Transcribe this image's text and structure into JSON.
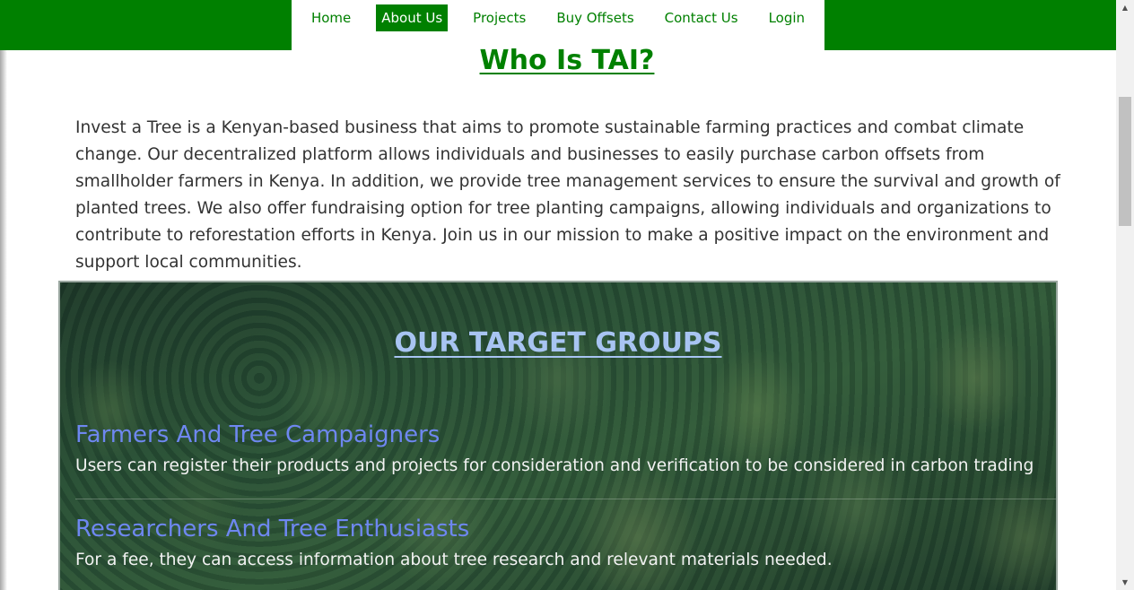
{
  "nav": {
    "items": [
      {
        "label": "Home"
      },
      {
        "label": "About Us"
      },
      {
        "label": "Projects"
      },
      {
        "label": "Buy Offsets"
      },
      {
        "label": "Contact Us"
      },
      {
        "label": "Login"
      }
    ],
    "active": "About Us"
  },
  "about": {
    "title": "Who Is TAI?",
    "body": "Invest a Tree is a Kenyan-based business that aims to promote sustainable farming practices and combat climate change. Our decentralized platform allows individuals and businesses to easily purchase carbon offsets from smallholder farmers in Kenya. In addition, we provide tree management services to ensure the survival and growth of planted trees. We also offer fundraising option for tree planting campaigns, allowing individuals and organizations to contribute to reforestation efforts in Kenya. Join us in our mission to make a positive impact on the environment and support local communities."
  },
  "target_groups": {
    "title": "OUR TARGET GROUPS",
    "groups": [
      {
        "heading": "Farmers And Tree Campaigners",
        "text": "Users can register their products and projects for consideration and verification to be considered in carbon trading"
      },
      {
        "heading": "Researchers And Tree Enthusiasts",
        "text": "For a fee, they can access information about tree research and relevant materials needed."
      }
    ]
  },
  "colors": {
    "brand_green": "#008000",
    "group_heading": "#6e87f0",
    "section_title": "#a8c4f2"
  },
  "icons": {
    "scroll_up": "scroll-up-arrow-icon",
    "scroll_down": "scroll-down-arrow-icon"
  }
}
